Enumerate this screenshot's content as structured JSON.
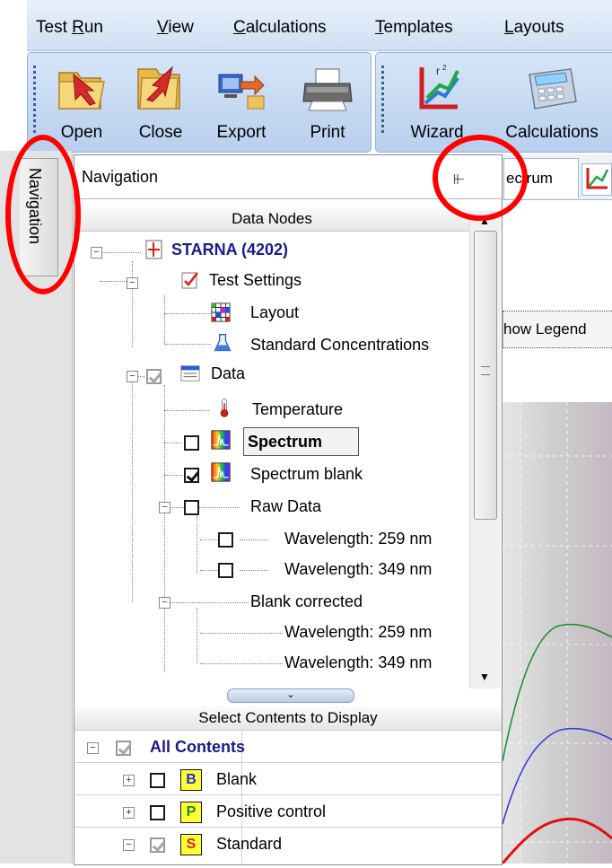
{
  "menu": [
    {
      "pre": "Test ",
      "ul": "R",
      "post": "un"
    },
    {
      "pre": "",
      "ul": "V",
      "post": "iew"
    },
    {
      "pre": "",
      "ul": "C",
      "post": "alculations"
    },
    {
      "pre": "",
      "ul": "T",
      "post": "emplates"
    },
    {
      "pre": "",
      "ul": "L",
      "post": "ayouts"
    }
  ],
  "toolbar": {
    "open": "Open",
    "close": "Close",
    "export": "Export",
    "print": "Print",
    "wizard": "Wizard",
    "calculations": "Calculations"
  },
  "side_tab": "Navigation",
  "nav": {
    "title": "Navigation",
    "pin_icon": "pin-icon",
    "data_nodes_header": "Data Nodes",
    "tree": {
      "root": "STARNA (4202)",
      "test_settings": "Test Settings",
      "layout": "Layout",
      "standard_concentrations": "Standard Concentrations",
      "data": "Data",
      "temperature": "Temperature",
      "spectrum": "Spectrum",
      "spectrum_blank": "Spectrum blank",
      "raw_data": "Raw Data",
      "raw_wl1": "Wavelength: 259 nm",
      "raw_wl2": "Wavelength: 349 nm",
      "blank_corrected": "Blank corrected",
      "bc_wl1": "Wavelength: 259 nm",
      "bc_wl2": "Wavelength: 349 nm"
    },
    "contents_header": "Select Contents to Display",
    "contents": {
      "all": "All Contents",
      "blank": "Blank",
      "blank_badge": "B",
      "positive": "Positive control",
      "positive_badge": "P",
      "standard": "Standard",
      "standard_badge": "S"
    }
  },
  "doc": {
    "tab_partial": "ectrum",
    "legend_partial": "how Legend"
  },
  "colors": {
    "annotation_red": "#ff0000",
    "tree_root_text": "#1a1a8c",
    "badge_b": "#1b2fd6",
    "badge_p": "#1c8a1c",
    "badge_s": "#d42020"
  }
}
